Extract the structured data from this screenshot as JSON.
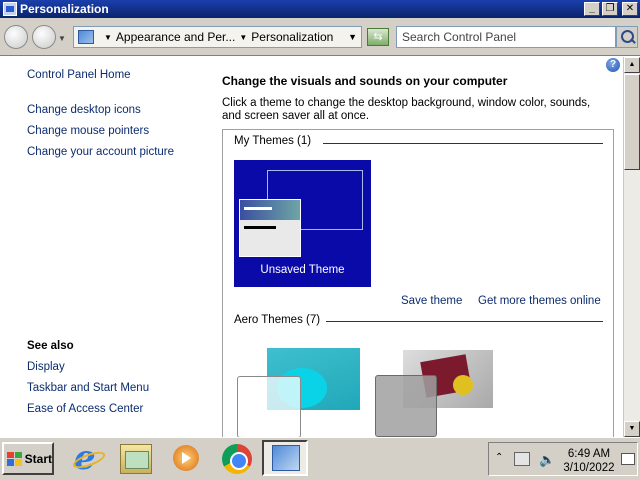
{
  "window": {
    "title": "Personalization"
  },
  "addressbar": {
    "crumb1": "Appearance and Per...",
    "crumb2": "Personalization",
    "search_placeholder": "Search Control Panel"
  },
  "sidebar": {
    "home": "Control Panel Home",
    "links": [
      "Change desktop icons",
      "Change mouse pointers",
      "Change your account picture"
    ],
    "see_also_title": "See also",
    "see_also": [
      "Display",
      "Taskbar and Start Menu",
      "Ease of Access Center"
    ]
  },
  "main": {
    "title": "Change the visuals and sounds on your computer",
    "description": "Click a theme to change the desktop background, window color, sounds, and screen saver all at once.",
    "my_themes_header": "My Themes (1)",
    "unsaved_theme_label": "Unsaved Theme",
    "save_theme": "Save theme",
    "get_more": "Get more themes online",
    "aero_header": "Aero Themes (7)"
  },
  "taskbar": {
    "start_label": "Start",
    "time": "6:49 AM",
    "date": "3/10/2022"
  },
  "colors": {
    "titlebar": "#0a246a",
    "link": "#0c2c6e",
    "theme_tile": "#0a0aa8"
  }
}
